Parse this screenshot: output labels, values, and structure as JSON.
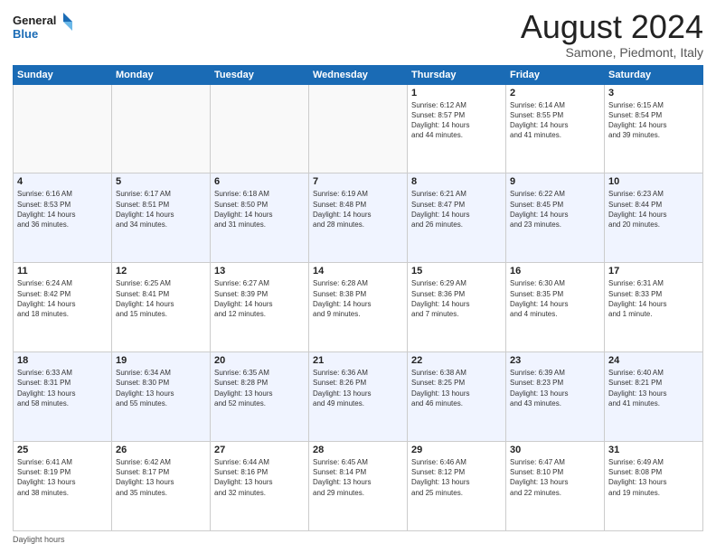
{
  "logo": {
    "line1": "General",
    "line2": "Blue"
  },
  "title": "August 2024",
  "location": "Samone, Piedmont, Italy",
  "days_header": [
    "Sunday",
    "Monday",
    "Tuesday",
    "Wednesday",
    "Thursday",
    "Friday",
    "Saturday"
  ],
  "footer": "Daylight hours",
  "weeks": [
    [
      {
        "day": "",
        "info": ""
      },
      {
        "day": "",
        "info": ""
      },
      {
        "day": "",
        "info": ""
      },
      {
        "day": "",
        "info": ""
      },
      {
        "day": "1",
        "info": "Sunrise: 6:12 AM\nSunset: 8:57 PM\nDaylight: 14 hours\nand 44 minutes."
      },
      {
        "day": "2",
        "info": "Sunrise: 6:14 AM\nSunset: 8:55 PM\nDaylight: 14 hours\nand 41 minutes."
      },
      {
        "day": "3",
        "info": "Sunrise: 6:15 AM\nSunset: 8:54 PM\nDaylight: 14 hours\nand 39 minutes."
      }
    ],
    [
      {
        "day": "4",
        "info": "Sunrise: 6:16 AM\nSunset: 8:53 PM\nDaylight: 14 hours\nand 36 minutes."
      },
      {
        "day": "5",
        "info": "Sunrise: 6:17 AM\nSunset: 8:51 PM\nDaylight: 14 hours\nand 34 minutes."
      },
      {
        "day": "6",
        "info": "Sunrise: 6:18 AM\nSunset: 8:50 PM\nDaylight: 14 hours\nand 31 minutes."
      },
      {
        "day": "7",
        "info": "Sunrise: 6:19 AM\nSunset: 8:48 PM\nDaylight: 14 hours\nand 28 minutes."
      },
      {
        "day": "8",
        "info": "Sunrise: 6:21 AM\nSunset: 8:47 PM\nDaylight: 14 hours\nand 26 minutes."
      },
      {
        "day": "9",
        "info": "Sunrise: 6:22 AM\nSunset: 8:45 PM\nDaylight: 14 hours\nand 23 minutes."
      },
      {
        "day": "10",
        "info": "Sunrise: 6:23 AM\nSunset: 8:44 PM\nDaylight: 14 hours\nand 20 minutes."
      }
    ],
    [
      {
        "day": "11",
        "info": "Sunrise: 6:24 AM\nSunset: 8:42 PM\nDaylight: 14 hours\nand 18 minutes."
      },
      {
        "day": "12",
        "info": "Sunrise: 6:25 AM\nSunset: 8:41 PM\nDaylight: 14 hours\nand 15 minutes."
      },
      {
        "day": "13",
        "info": "Sunrise: 6:27 AM\nSunset: 8:39 PM\nDaylight: 14 hours\nand 12 minutes."
      },
      {
        "day": "14",
        "info": "Sunrise: 6:28 AM\nSunset: 8:38 PM\nDaylight: 14 hours\nand 9 minutes."
      },
      {
        "day": "15",
        "info": "Sunrise: 6:29 AM\nSunset: 8:36 PM\nDaylight: 14 hours\nand 7 minutes."
      },
      {
        "day": "16",
        "info": "Sunrise: 6:30 AM\nSunset: 8:35 PM\nDaylight: 14 hours\nand 4 minutes."
      },
      {
        "day": "17",
        "info": "Sunrise: 6:31 AM\nSunset: 8:33 PM\nDaylight: 14 hours\nand 1 minute."
      }
    ],
    [
      {
        "day": "18",
        "info": "Sunrise: 6:33 AM\nSunset: 8:31 PM\nDaylight: 13 hours\nand 58 minutes."
      },
      {
        "day": "19",
        "info": "Sunrise: 6:34 AM\nSunset: 8:30 PM\nDaylight: 13 hours\nand 55 minutes."
      },
      {
        "day": "20",
        "info": "Sunrise: 6:35 AM\nSunset: 8:28 PM\nDaylight: 13 hours\nand 52 minutes."
      },
      {
        "day": "21",
        "info": "Sunrise: 6:36 AM\nSunset: 8:26 PM\nDaylight: 13 hours\nand 49 minutes."
      },
      {
        "day": "22",
        "info": "Sunrise: 6:38 AM\nSunset: 8:25 PM\nDaylight: 13 hours\nand 46 minutes."
      },
      {
        "day": "23",
        "info": "Sunrise: 6:39 AM\nSunset: 8:23 PM\nDaylight: 13 hours\nand 43 minutes."
      },
      {
        "day": "24",
        "info": "Sunrise: 6:40 AM\nSunset: 8:21 PM\nDaylight: 13 hours\nand 41 minutes."
      }
    ],
    [
      {
        "day": "25",
        "info": "Sunrise: 6:41 AM\nSunset: 8:19 PM\nDaylight: 13 hours\nand 38 minutes."
      },
      {
        "day": "26",
        "info": "Sunrise: 6:42 AM\nSunset: 8:17 PM\nDaylight: 13 hours\nand 35 minutes."
      },
      {
        "day": "27",
        "info": "Sunrise: 6:44 AM\nSunset: 8:16 PM\nDaylight: 13 hours\nand 32 minutes."
      },
      {
        "day": "28",
        "info": "Sunrise: 6:45 AM\nSunset: 8:14 PM\nDaylight: 13 hours\nand 29 minutes."
      },
      {
        "day": "29",
        "info": "Sunrise: 6:46 AM\nSunset: 8:12 PM\nDaylight: 13 hours\nand 25 minutes."
      },
      {
        "day": "30",
        "info": "Sunrise: 6:47 AM\nSunset: 8:10 PM\nDaylight: 13 hours\nand 22 minutes."
      },
      {
        "day": "31",
        "info": "Sunrise: 6:49 AM\nSunset: 8:08 PM\nDaylight: 13 hours\nand 19 minutes."
      }
    ]
  ]
}
